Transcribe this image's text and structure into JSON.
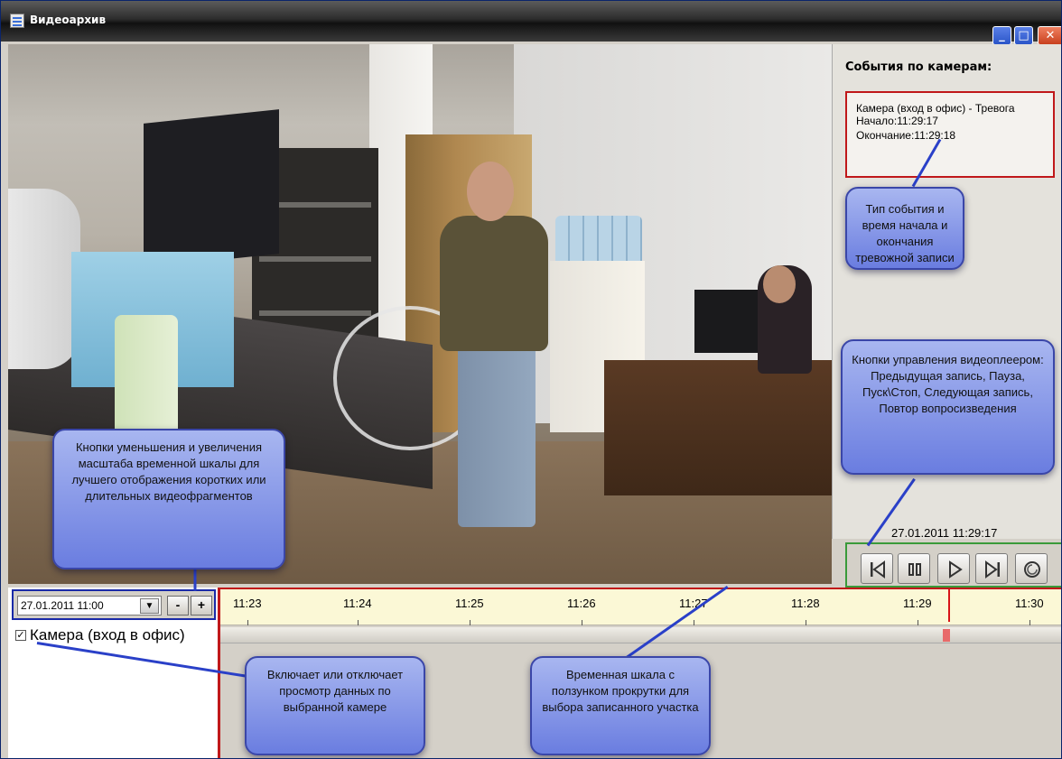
{
  "window": {
    "title": "Видеоархив",
    "buttons": {
      "minimize": "_",
      "maximize": "□",
      "close": "✕"
    }
  },
  "events_panel": {
    "title": "События по камерам:",
    "events": [
      {
        "camera": "Камера (вход в офис) - Тревога",
        "start": "Начало:11:29:17",
        "end": "Окончание:11:29:18"
      }
    ]
  },
  "player": {
    "timestamp": "27.01.2011 11:29:17",
    "buttons": [
      {
        "name": "previous-record-button",
        "icon": "skip-back-icon"
      },
      {
        "name": "pause-button",
        "icon": "pause-icon"
      },
      {
        "name": "play-stop-button",
        "icon": "play-icon"
      },
      {
        "name": "next-record-button",
        "icon": "skip-forward-icon"
      },
      {
        "name": "repeat-button",
        "icon": "repeat-icon"
      }
    ]
  },
  "timeline_controls": {
    "date_value": "27.01.2011 11:00",
    "zoom_out_label": "-",
    "zoom_in_label": "+"
  },
  "cameras": [
    {
      "label": "Камера (вход в офис)",
      "checked": true
    }
  ],
  "timeline": {
    "ticks": [
      "11:23",
      "11:24",
      "11:25",
      "11:26",
      "11:27",
      "11:28",
      "11:29",
      "11:30"
    ],
    "cursor_time": "11:29:17",
    "accent_color": "#d81418"
  },
  "callouts": {
    "event_info": "Тип события и время начала и окончания тревожной записи",
    "player_controls": "Кнопки управления видеоплеером: Предыдущая запись, Пауза, Пуск\\Стоп, Следующая запись, Повтор вопросизведения",
    "zoom": "Кнопки уменьшения и увеличения масштаба временной шкалы  для лучшего отображения коротких или длительных видеофрагментов",
    "camera_toggle": "Включает или отключает просмотр данных по выбранной камере",
    "timeline": "Временная шкала с ползунком прокрутки для выбора записанного участка"
  }
}
